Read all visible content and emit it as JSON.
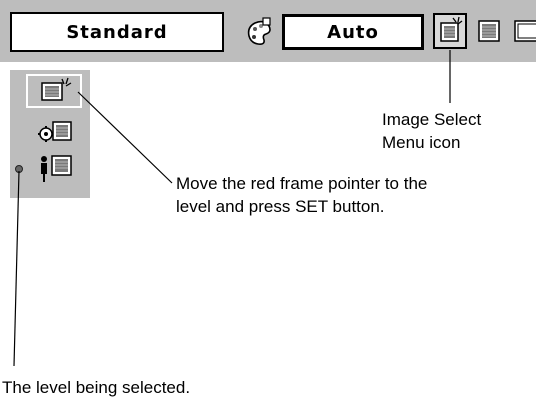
{
  "topbar": {
    "standard_label": "Standard",
    "auto_label": "Auto"
  },
  "callouts": {
    "image_select": [
      "Image Select",
      "Menu icon"
    ],
    "move_pointer": [
      "Move the red frame pointer to the",
      "level and press SET button."
    ],
    "level_selected": "The level being selected."
  },
  "icons": [
    "gear-palette-icon",
    "image-select-icon",
    "image-adjust-icon",
    "screen-icon",
    "level-1-icon",
    "level-2-icon",
    "level-3-icon",
    "selection-dot-icon"
  ]
}
